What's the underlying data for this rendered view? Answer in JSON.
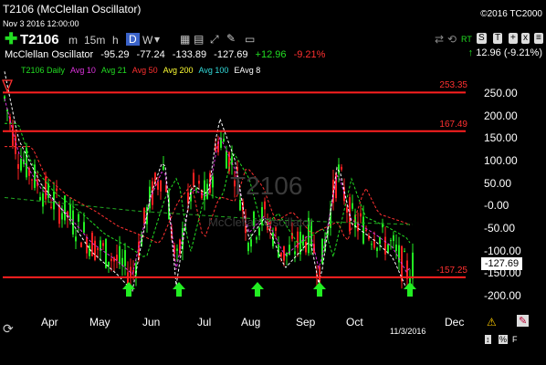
{
  "header": {
    "title": "T2106 (McClellan Oscillator)",
    "date": "Nov 3 2016 12:00:00",
    "copyright": "©2016 TC2000"
  },
  "toolbar": {
    "symbol": "T2106",
    "intervals": [
      "m",
      "15m",
      "h",
      "D",
      "W"
    ],
    "active_interval": "D",
    "right_badges": [
      "S",
      "T",
      "RT"
    ],
    "change": "12.96 (-9.21%)"
  },
  "study": {
    "name": "McClellan Oscillator",
    "values": [
      "-95.29",
      "-77.24",
      "-133.89",
      "-127.69",
      "+12.96",
      "-9.21%"
    ]
  },
  "legend": [
    {
      "label": "T2106 Daily",
      "color": "#22dd22"
    },
    {
      "label": "Avg 10",
      "color": "#dd33dd"
    },
    {
      "label": "Avg 21",
      "color": "#22dd22"
    },
    {
      "label": "Avg 50",
      "color": "#ff3030"
    },
    {
      "label": "Avg 200",
      "color": "#ffff33"
    },
    {
      "label": "Avg 100",
      "color": "#33dddd"
    },
    {
      "label": "EAvg 8",
      "color": "#ffffff"
    }
  ],
  "watermark": {
    "symbol": "T2106",
    "name": "McClellan Oscillator"
  },
  "chart_data": {
    "type": "candlestick",
    "y_ticks": [
      "250.00",
      "200.00",
      "150.00",
      "100.00",
      "50.00",
      "-0.00",
      "-50.00",
      "-100.00",
      "-150.00",
      "-200.00"
    ],
    "x_ticks": [
      "Apr",
      "May",
      "Jun",
      "Jul",
      "Aug",
      "Sep",
      "Oct",
      "Dec"
    ],
    "ylim": [
      -215,
      285
    ],
    "current_value": "-127.69",
    "current_date": "11/3/2016",
    "horizontal_lines": [
      {
        "value": 253.35,
        "label": "253.35"
      },
      {
        "value": 167.49,
        "label": "167.49"
      },
      {
        "value": -157.25,
        "label": "-157.25"
      }
    ],
    "buy_arrows": [
      "May",
      "Jun",
      "Aug",
      "Sep",
      "Nov"
    ]
  },
  "icons": [
    "plus-icon",
    "chart-settings-icon",
    "drawing-icon",
    "warning-icon",
    "pencil-icon",
    "refresh-icon"
  ]
}
